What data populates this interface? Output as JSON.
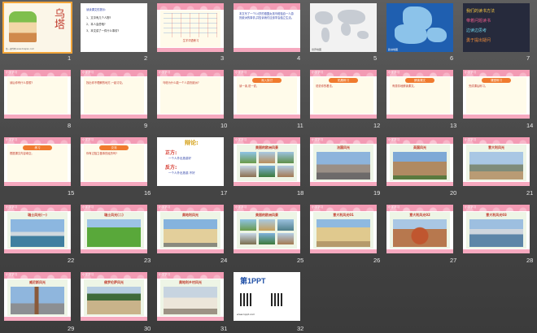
{
  "view": "slide-sorter",
  "slides": [
    {
      "n": "1",
      "title": "乌塔",
      "subtitle": "第一课件网 www.1kejian.com"
    },
    {
      "n": "2",
      "heading": "读读课文的提示:",
      "lines": [
        "1、文中有几个人物?",
        "2、本人会些啥?",
        "3、本文讲了一件什么事情?"
      ]
    },
    {
      "n": "3",
      "words": "生字词语练习"
    },
    {
      "n": "4",
      "text": "本文写了一个14岁的德国女孩乌塔独自一人游历欧洲的事情,并告诉我们应该学会独立生活。"
    },
    {
      "n": "5",
      "caption": "世界地图"
    },
    {
      "n": "6",
      "caption": "欧洲地图"
    },
    {
      "n": "7",
      "lines": [
        "我们的读书方法",
        "带着问题读书",
        "边读边思考",
        "勇于提出疑问"
      ]
    },
    {
      "n": "8",
      "tag": "小学学习",
      "text": "读后你有什么感想?"
    },
    {
      "n": "9",
      "tag": "小学学习",
      "btn": "提出疑问",
      "text": "找出你不理解的地方,一起讨论。"
    },
    {
      "n": "10",
      "tag": "小学学习",
      "btn": "合作探究",
      "text": "乌塔为什么能一个人游历欧洲?"
    },
    {
      "n": "11",
      "tag": "小学学习",
      "btn": "深入探讨",
      "text": "读一读,说一说。"
    },
    {
      "n": "12",
      "tag": "小学学习",
      "btn": "拓展练习",
      "text": "说说你的看法。"
    },
    {
      "n": "13",
      "tag": "小学学习",
      "btn": "朗读课文",
      "text": "有感情地朗读课文。"
    },
    {
      "n": "14",
      "tag": "小学学习",
      "btn": "课堂练习",
      "text": "完成课后练习。"
    },
    {
      "n": "15",
      "tag": "小学学习",
      "btn": "练习",
      "text": "根据课文内容填空。"
    },
    {
      "n": "16",
      "tag": "小学学习",
      "btn": "交流",
      "text": "你有过独立做事的经历吗?"
    },
    {
      "n": "17",
      "heading": "辩论:",
      "pro": "正方:",
      "pro_line": "一个人外出旅游好",
      "con": "反方:",
      "con_line": "一个人外出旅游,不好"
    },
    {
      "n": "18",
      "tag": "小学学习",
      "title": "美丽的欧洲风景"
    },
    {
      "n": "19",
      "tag": "小学学习",
      "title": "法国风光"
    },
    {
      "n": "20",
      "tag": "小学学习",
      "title": "英国风光"
    },
    {
      "n": "21",
      "tag": "小学学习",
      "title": "意大利风光"
    },
    {
      "n": "22",
      "tag": "小学学习",
      "title": "瑞士风光(一)"
    },
    {
      "n": "23",
      "tag": "小学学习",
      "title": "瑞士风光(二)"
    },
    {
      "n": "24",
      "tag": "小学学习",
      "title": "奥地利风光"
    },
    {
      "n": "25",
      "tag": "小学学习",
      "title": "美丽的欧洲风景"
    },
    {
      "n": "26",
      "tag": "小学学习",
      "title": "意大利风光01"
    },
    {
      "n": "27",
      "tag": "小学学习",
      "title": "意大利风光02"
    },
    {
      "n": "28",
      "tag": "小学学习",
      "title": "意大利风光03"
    },
    {
      "n": "29",
      "tag": "小学学习",
      "title": "威尼斯风光"
    },
    {
      "n": "30",
      "tag": "小学学习",
      "title": "佛罗伦萨风光"
    },
    {
      "n": "31",
      "tag": "小学学习",
      "title": "奥地利乡村风光"
    },
    {
      "n": "32",
      "brand": "第1PPT",
      "footer": "www.1ppt.com"
    }
  ],
  "colors": {
    "accent": "#f39bb4",
    "frame": "#f6a9bf",
    "selection": "#f2a53a"
  }
}
